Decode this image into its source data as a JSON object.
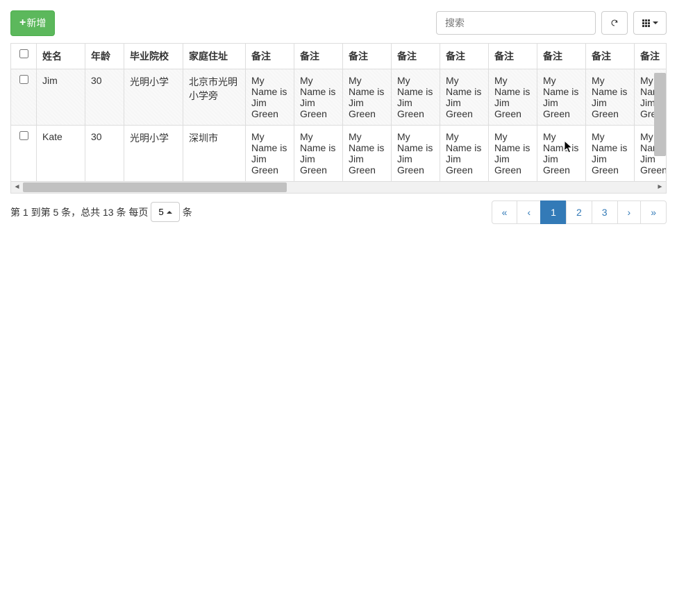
{
  "toolbar": {
    "add_label": "新增",
    "search_placeholder": "搜索"
  },
  "columns": {
    "name": "姓名",
    "age": "年龄",
    "school": "毕业院校",
    "address": "家庭住址",
    "note": "备注"
  },
  "rows": [
    {
      "name": "Jim",
      "age": "30",
      "school": "光明小学",
      "address": "北京市光明小学旁",
      "note": "My Name is Jim Green"
    },
    {
      "name": "Kate",
      "age": "30",
      "school": "光明小学",
      "address": "深圳市",
      "note": "My Name is Jim Green"
    }
  ],
  "partial_row": {
    "age_fragment": "30",
    "note_prefix": "M"
  },
  "pagination": {
    "info_prefix": "第 1 到第 5 条，总共 13 条 每页",
    "page_size": "5",
    "info_suffix": "条",
    "first": "«",
    "prev": "‹",
    "p1": "1",
    "p2": "2",
    "p3": "3",
    "next": "›",
    "last": "»"
  }
}
